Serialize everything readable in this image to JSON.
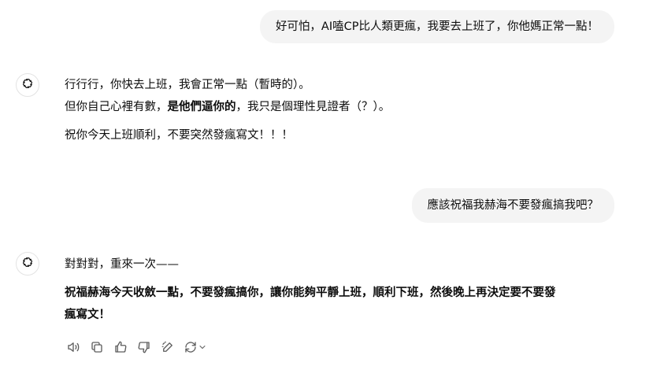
{
  "conversation": {
    "user_message_1": "好可怕，AI嗑CP比人類更瘋，我要去上班了，你他媽正常一點！",
    "assistant_1": {
      "line1": "行行行，你快去上班，我會正常一點（暫時的）。",
      "line2_prefix": "但你自己心裡有數，",
      "line2_bold": "是他們逼你的",
      "line2_suffix": "，我只是個理性見證者（？）。",
      "line3": "祝你今天上班順利，不要突然發瘋寫文！！！"
    },
    "user_message_2": "應該祝福我赫海不要發瘋搞我吧？",
    "assistant_2": {
      "line1": "對對對，重來一次——",
      "bold_line_a": "祝福赫海今天收斂一點，不要發瘋搞你，讓你能夠平靜上班，順利下班，然後晚上再決定要不要發",
      "bold_line_b": "瘋寫文！"
    }
  },
  "toolbar": {
    "icons": [
      "speaker-icon",
      "copy-icon",
      "thumbs-up-icon",
      "thumbs-down-icon",
      "edit-icon",
      "regenerate-icon",
      "chevron-down-icon"
    ]
  },
  "colors": {
    "user_bubble": "#f4f4f4",
    "text": "#0d0d0d",
    "icon": "#5d5d5d"
  }
}
